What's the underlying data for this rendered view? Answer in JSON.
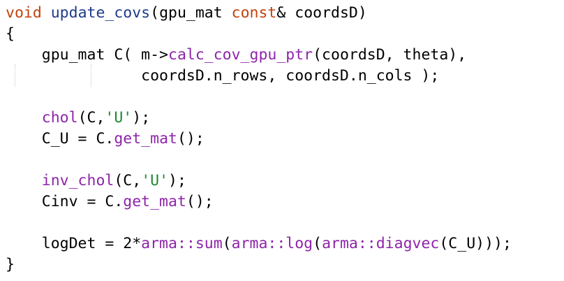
{
  "code": {
    "language": "C++",
    "lines": [
      [
        {
          "text": "void",
          "kind": "kw"
        },
        {
          "text": " ",
          "kind": "blk"
        },
        {
          "text": "update_covs",
          "kind": "fn"
        },
        {
          "text": "(gpu_mat ",
          "kind": "blk"
        },
        {
          "text": "const",
          "kind": "kw"
        },
        {
          "text": "& coordsD)",
          "kind": "blk"
        }
      ],
      [
        {
          "text": "{",
          "kind": "blk"
        }
      ],
      [
        {
          "text": "    gpu_mat C( m->",
          "kind": "blk"
        },
        {
          "text": "calc_cov_gpu_ptr",
          "kind": "call"
        },
        {
          "text": "(coordsD, theta),",
          "kind": "blk"
        }
      ],
      [
        {
          "text": "               coordsD.n_rows, coordsD.n_cols );",
          "kind": "blk"
        }
      ],
      [],
      [
        {
          "text": "    ",
          "kind": "blk"
        },
        {
          "text": "chol",
          "kind": "call"
        },
        {
          "text": "(C,",
          "kind": "blk"
        },
        {
          "text": "'U'",
          "kind": "str"
        },
        {
          "text": ");",
          "kind": "blk"
        }
      ],
      [
        {
          "text": "    C_U = C.",
          "kind": "blk"
        },
        {
          "text": "get_mat",
          "kind": "call"
        },
        {
          "text": "();",
          "kind": "blk"
        }
      ],
      [],
      [
        {
          "text": "    ",
          "kind": "blk"
        },
        {
          "text": "inv_chol",
          "kind": "call"
        },
        {
          "text": "(C,",
          "kind": "blk"
        },
        {
          "text": "'U'",
          "kind": "str"
        },
        {
          "text": ");",
          "kind": "blk"
        }
      ],
      [
        {
          "text": "    Cinv = C.",
          "kind": "blk"
        },
        {
          "text": "get_mat",
          "kind": "call"
        },
        {
          "text": "();",
          "kind": "blk"
        }
      ],
      [],
      [
        {
          "text": "    logDet = 2*",
          "kind": "blk"
        },
        {
          "text": "arma::sum",
          "kind": "call"
        },
        {
          "text": "(",
          "kind": "blk"
        },
        {
          "text": "arma::log",
          "kind": "call"
        },
        {
          "text": "(",
          "kind": "blk"
        },
        {
          "text": "arma::diagvec",
          "kind": "call"
        },
        {
          "text": "(C_U)));",
          "kind": "blk"
        }
      ],
      [
        {
          "text": "}",
          "kind": "blk"
        }
      ]
    ]
  }
}
